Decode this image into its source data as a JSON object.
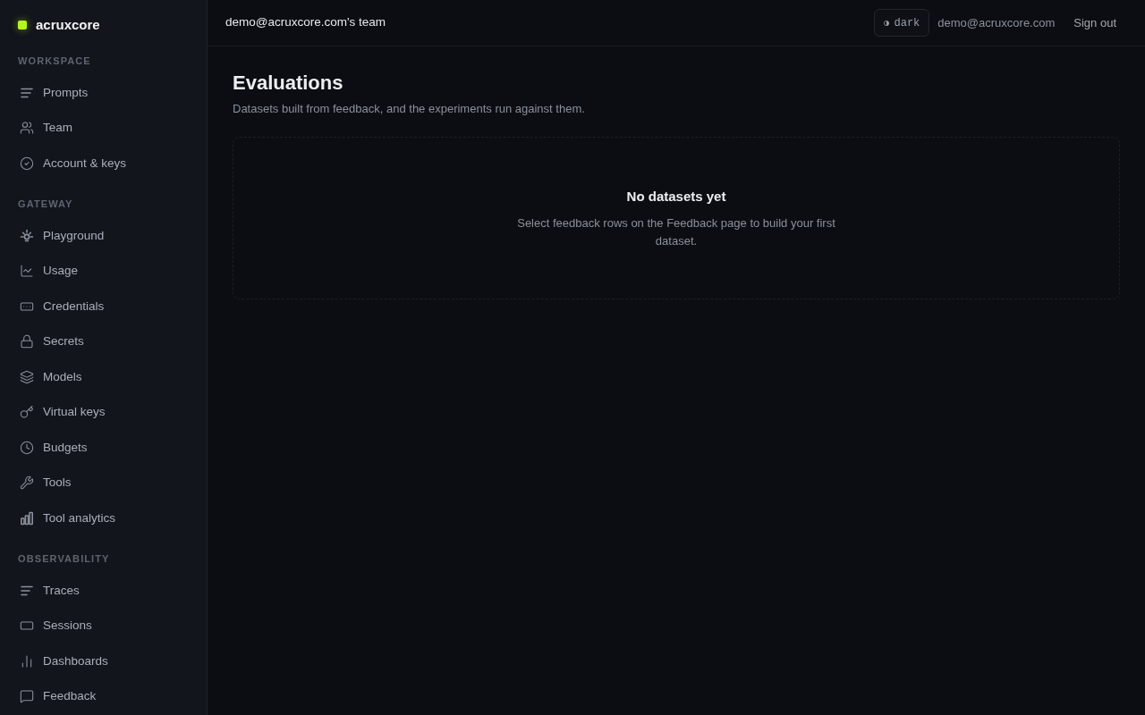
{
  "sidebar": {
    "brand": "acruxcore",
    "sections": [
      {
        "heading": "WORKSPACE",
        "items": [
          {
            "label": "Prompts"
          },
          {
            "label": "Team"
          },
          {
            "label": "Account & keys"
          }
        ]
      },
      {
        "heading": "GATEWAY",
        "items": [
          {
            "label": "Playground"
          },
          {
            "label": "Usage"
          },
          {
            "label": "Credentials"
          },
          {
            "label": "Secrets"
          },
          {
            "label": "Models"
          },
          {
            "label": "Virtual keys"
          },
          {
            "label": "Budgets"
          },
          {
            "label": "Tools"
          },
          {
            "label": "Tool analytics"
          }
        ]
      },
      {
        "heading": "OBSERVABILITY",
        "items": [
          {
            "label": "Traces"
          },
          {
            "label": "Sessions"
          },
          {
            "label": "Dashboards"
          },
          {
            "label": "Feedback"
          }
        ]
      }
    ]
  },
  "top_bar": {
    "team": "demo@acruxcore.com's team",
    "theme_toggle": {
      "label": "dark"
    },
    "user_email": "demo@acruxcore.com",
    "sign_out": "Sign out"
  },
  "page": {
    "title": "Evaluations",
    "subtitle": "Datasets built from feedback, and the experiments run against them.",
    "empty_state": {
      "title": "No datasets yet",
      "description": "Select feedback rows on the Feedback page to build your first dataset."
    }
  }
}
